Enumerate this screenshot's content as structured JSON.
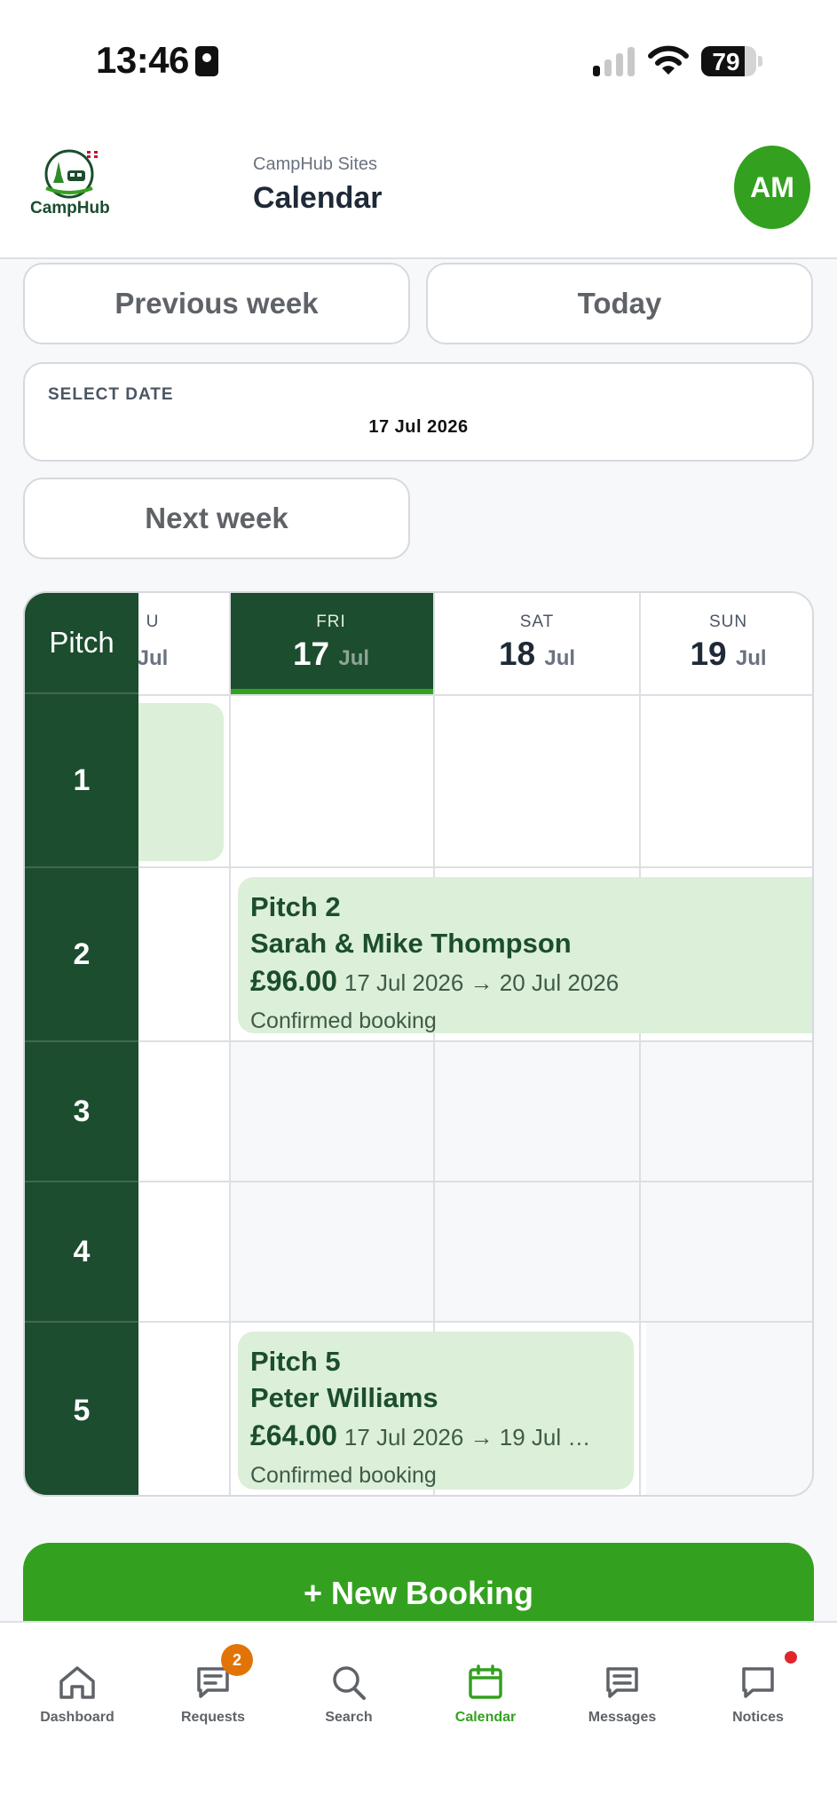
{
  "status_bar": {
    "time": "13:46",
    "battery": "79",
    "battery_level": 0.79
  },
  "header": {
    "brand": "CampHub",
    "subtitle": "CampHub Sites",
    "title": "Calendar",
    "avatar_initials": "AM"
  },
  "controls": {
    "previous_week": "Previous week",
    "today": "Today",
    "select_date_label": "SELECT DATE",
    "selected_date": "17 Jul 2026",
    "next_week": "Next week"
  },
  "calendar": {
    "pitch_header": "Pitch",
    "days": [
      {
        "dow": "U",
        "day": "",
        "month": "Jul"
      },
      {
        "dow": "FRI",
        "day": "17",
        "month": "Jul"
      },
      {
        "dow": "SAT",
        "day": "18",
        "month": "Jul"
      },
      {
        "dow": "SUN",
        "day": "19",
        "month": "Jul"
      }
    ],
    "pitches": [
      "1",
      "2",
      "3",
      "4",
      "5"
    ],
    "bookings": [
      {
        "pitch": "Pitch 2",
        "guest": "Sarah & Mike Thompson",
        "price": "£96.00",
        "range": "17 Jul 2026 → 20 Jul 2026",
        "status": "Confirmed booking"
      },
      {
        "pitch": "Pitch 5",
        "guest": "Peter Williams",
        "price": "£64.00",
        "range": "17 Jul 2026 → 19 Jul …",
        "status": "Confirmed booking"
      }
    ]
  },
  "new_booking_label": "+ New Booking",
  "tabs": [
    {
      "label": "Dashboard",
      "icon": "home-icon"
    },
    {
      "label": "Requests",
      "icon": "requests-icon",
      "badge": "2"
    },
    {
      "label": "Search",
      "icon": "search-icon"
    },
    {
      "label": "Calendar",
      "icon": "calendar-icon",
      "active": true
    },
    {
      "label": "Messages",
      "icon": "messages-icon"
    },
    {
      "label": "Notices",
      "icon": "notices-icon",
      "dot": true
    }
  ],
  "colors": {
    "brand_green": "#33a11f",
    "dark_green": "#1b4d2e",
    "booking_bg": "#dcefd8",
    "badge_orange": "#e27407",
    "dot_red": "#e0262b"
  }
}
